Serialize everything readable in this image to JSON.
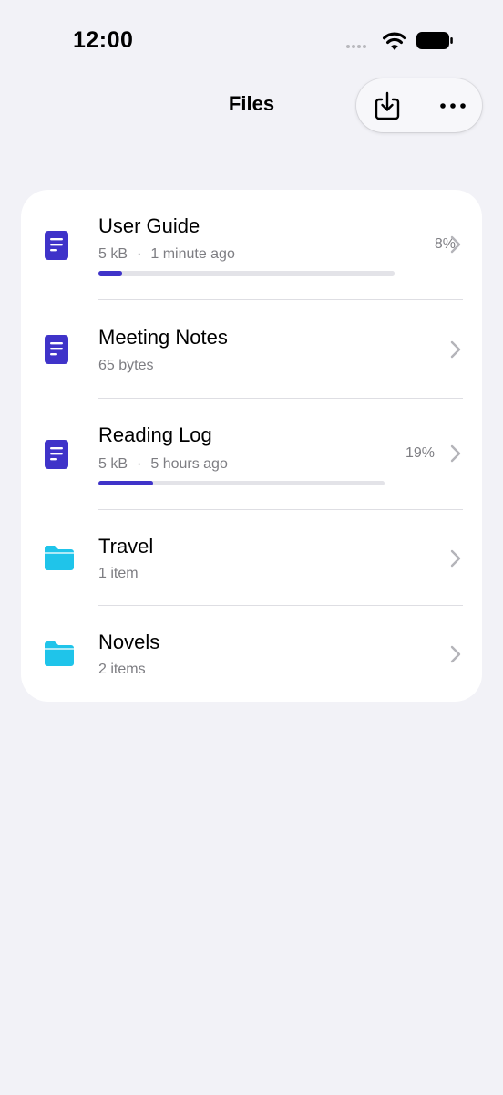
{
  "status_bar": {
    "time": "12:00"
  },
  "header": {
    "title": "Files"
  },
  "colors": {
    "accent": "#3f33c9",
    "folder": "#1fc4ea",
    "background": "#f2f2f7"
  },
  "files": [
    {
      "type": "document",
      "icon": "document-icon",
      "name": "User Guide",
      "size": "5 kB",
      "separator": "·",
      "modified": "1 minute ago",
      "percent_label": "8%",
      "progress": 0.08
    },
    {
      "type": "document",
      "icon": "document-icon",
      "name": "Meeting Notes",
      "size": "65 bytes"
    },
    {
      "type": "document",
      "icon": "document-icon",
      "name": "Reading Log",
      "size": "5 kB",
      "separator": "·",
      "modified": "5 hours ago",
      "percent_label": "19%",
      "progress": 0.19
    },
    {
      "type": "folder",
      "icon": "folder-icon",
      "name": "Travel",
      "count": "1 item"
    },
    {
      "type": "folder",
      "icon": "folder-icon",
      "name": "Novels",
      "count": "2 items"
    }
  ]
}
